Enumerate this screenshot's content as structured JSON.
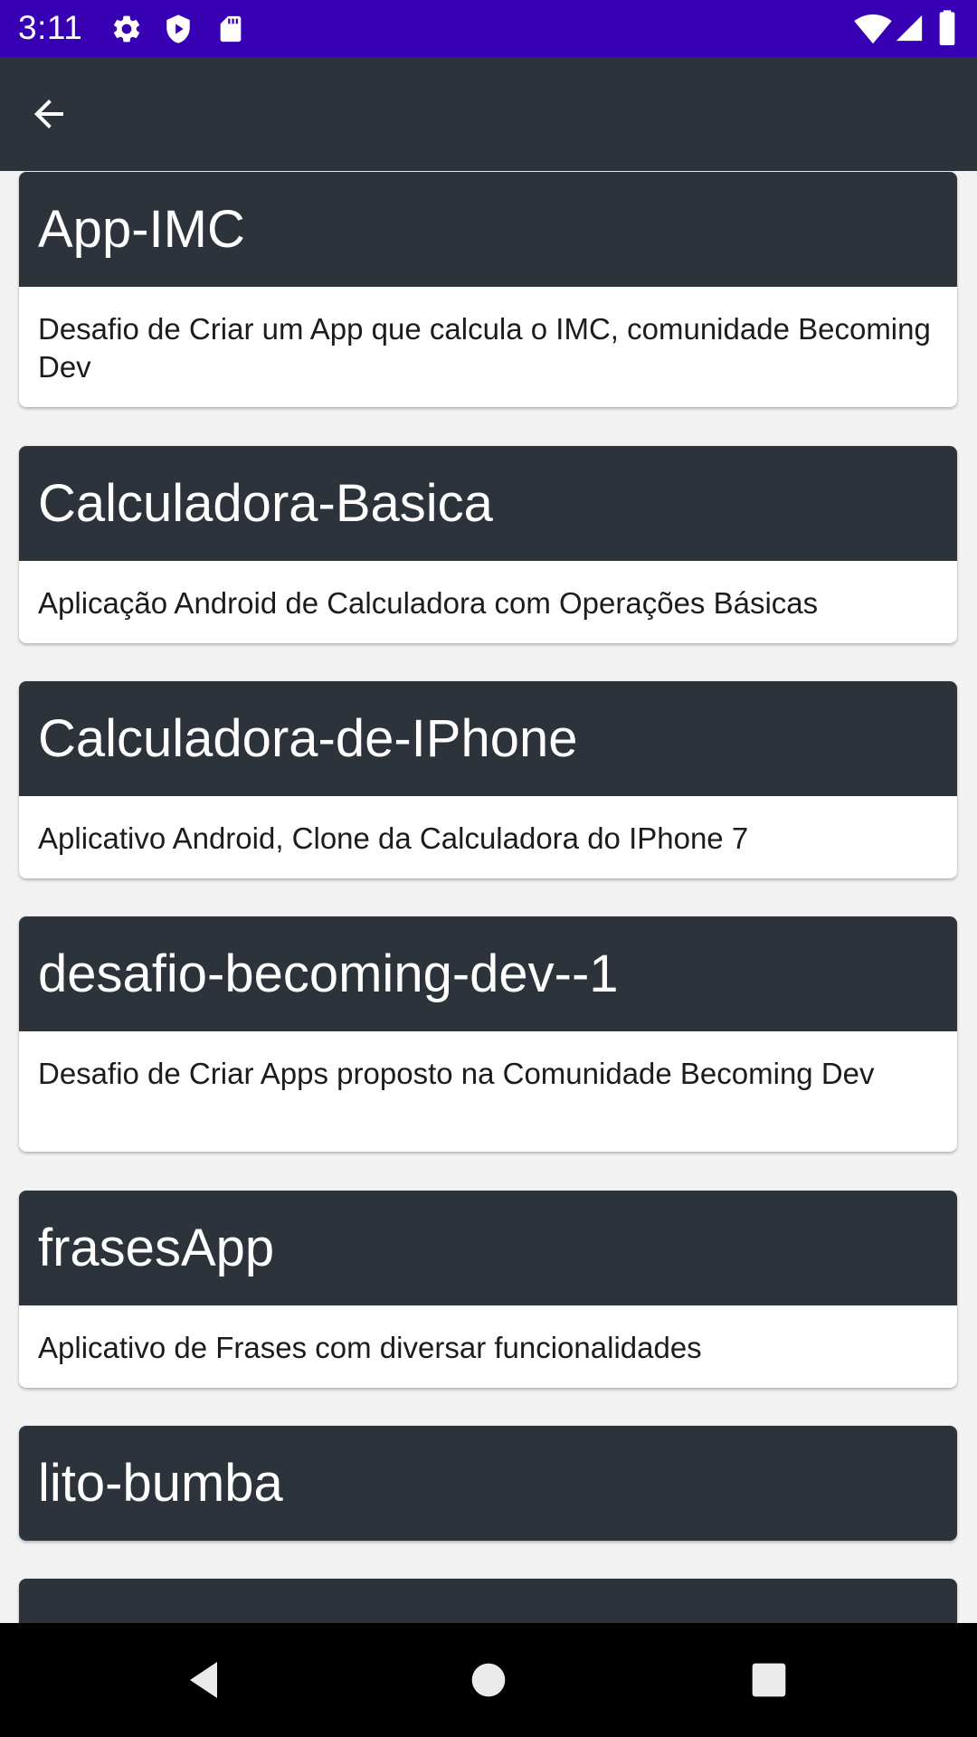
{
  "status_bar": {
    "time": "3:11",
    "left_icons": [
      "gear-icon",
      "shield-icon",
      "sd-card-icon"
    ],
    "right_icons": [
      "wifi-icon",
      "cell-signal-icon",
      "battery-icon"
    ],
    "background": "#3700b3"
  },
  "app_bar": {
    "back_icon": "arrow-back-icon",
    "background": "#2d333b"
  },
  "repos": [
    {
      "name": "App-IMC",
      "description": "Desafio de Criar um App que calcula o IMC, comunidade Becoming Dev"
    },
    {
      "name": "Calculadora-Basica",
      "description": "Aplicação Android de Calculadora com Operações Básicas"
    },
    {
      "name": "Calculadora-de-IPhone",
      "description": "Aplicativo Android, Clone da Calculadora do IPhone 7"
    },
    {
      "name": "desafio-becoming-dev--1",
      "description": "Desafio de Criar Apps proposto na Comunidade Becoming Dev"
    },
    {
      "name": "frasesApp",
      "description": "Aplicativo de Frases com diversar funcionalidades"
    },
    {
      "name": "lito-bumba",
      "description": ""
    },
    {
      "name": "",
      "description": ""
    }
  ],
  "nav_bar": {
    "buttons": [
      "nav-back-icon",
      "nav-home-icon",
      "nav-recents-icon"
    ]
  },
  "colors": {
    "card_header": "#2d333b",
    "card_body": "#ffffff",
    "list_background": "#f2f2f2"
  }
}
